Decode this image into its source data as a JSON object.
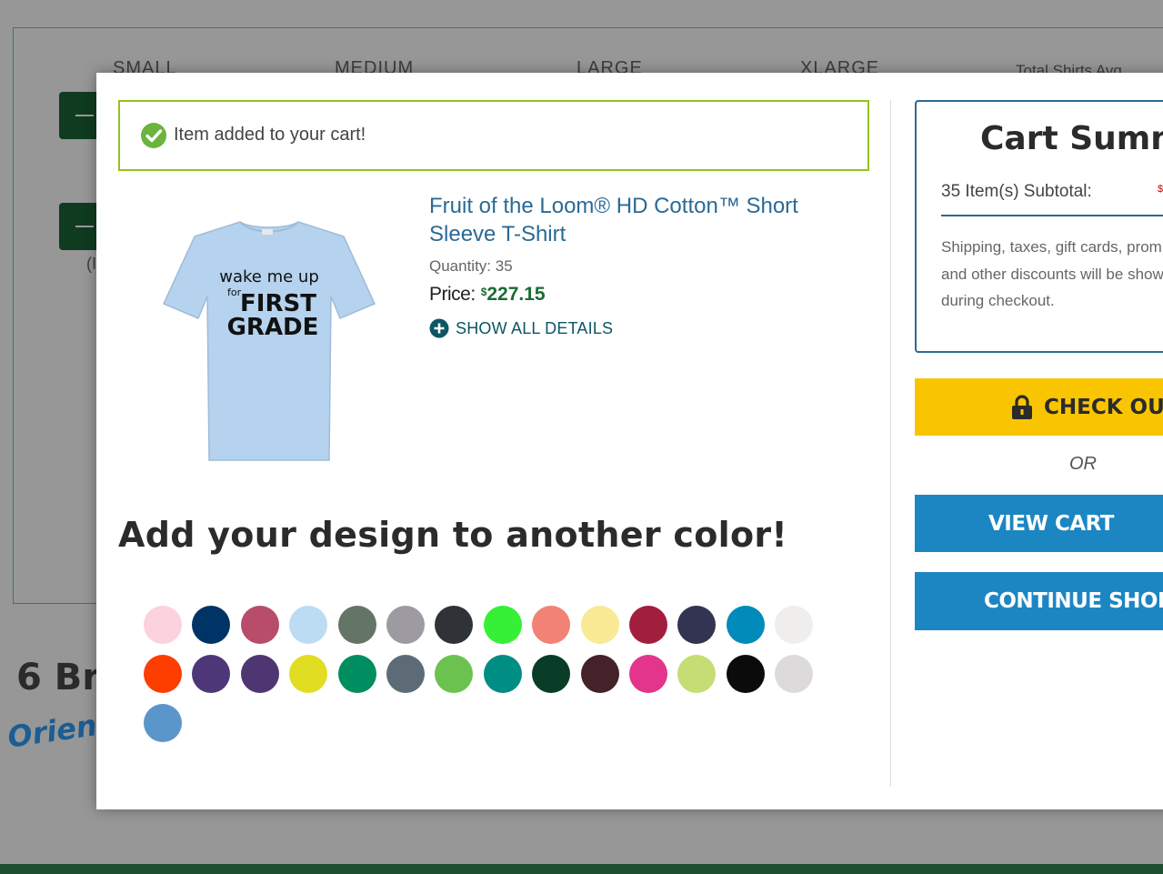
{
  "background": {
    "sizes": [
      "SMALL",
      "MEDIUM",
      "LARGE",
      "XLARGE"
    ],
    "total_label": "Total Shirts   Avg",
    "paren": "(I",
    "heading": "6 Br",
    "script_text": "Orienta"
  },
  "alert": {
    "text": "Item added to your cart!",
    "icon": "check-circle-icon",
    "border_color": "#95c11f"
  },
  "product": {
    "name": "Fruit of the Loom® HD Cotton™ Short Sleeve T-Shirt",
    "quantity_text": "Quantity: 35",
    "price_label": "Price:",
    "price_currency": "$",
    "price_value": "227.15",
    "details_link": "SHOW ALL DETAILS",
    "shirt_color": "#b5d2ee",
    "shirt_text_line1": "wake me up",
    "shirt_text_for": "for",
    "shirt_text_line2": "FIRST",
    "shirt_text_line3": "GRADE"
  },
  "design": {
    "heading": "Add your design to another color!",
    "swatches": [
      "#fcd2dc",
      "#003366",
      "#b84c6b",
      "#bcdcf3",
      "#647566",
      "#9d9ba1",
      "#2f3236",
      "#36f036",
      "#f28274",
      "#fae995",
      "#a21e3e",
      "#333352",
      "#008bbb",
      "#efeeed",
      "#fe3d00",
      "#4d3778",
      "#4e3673",
      "#e1dd22",
      "#008d5f",
      "#5d6b76",
      "#6cc24e",
      "#008d83",
      "#0a3d27",
      "#442229",
      "#e2358b",
      "#c6dd76",
      "#0b0b0c",
      "#dddadb",
      "#5b96ca"
    ]
  },
  "summary": {
    "title": "Cart Summar",
    "subtotal_label": "35 Item(s) Subtotal:",
    "subtotal_value": "$",
    "note_line1": "Shipping, taxes, gift cards, prom",
    "note_line2": "and other discounts will be show",
    "note_line3": "during checkout."
  },
  "buttons": {
    "checkout": "CHECK OUT",
    "or": "OR",
    "view_cart": "VIEW CART",
    "continue_shopping": "CONTINUE SHOPPIN"
  },
  "colors": {
    "brand_blue": "#1c86c3",
    "checkout_yellow": "#f8c500",
    "price_green": "#1c6b33",
    "footer_green": "#1c4e30"
  }
}
